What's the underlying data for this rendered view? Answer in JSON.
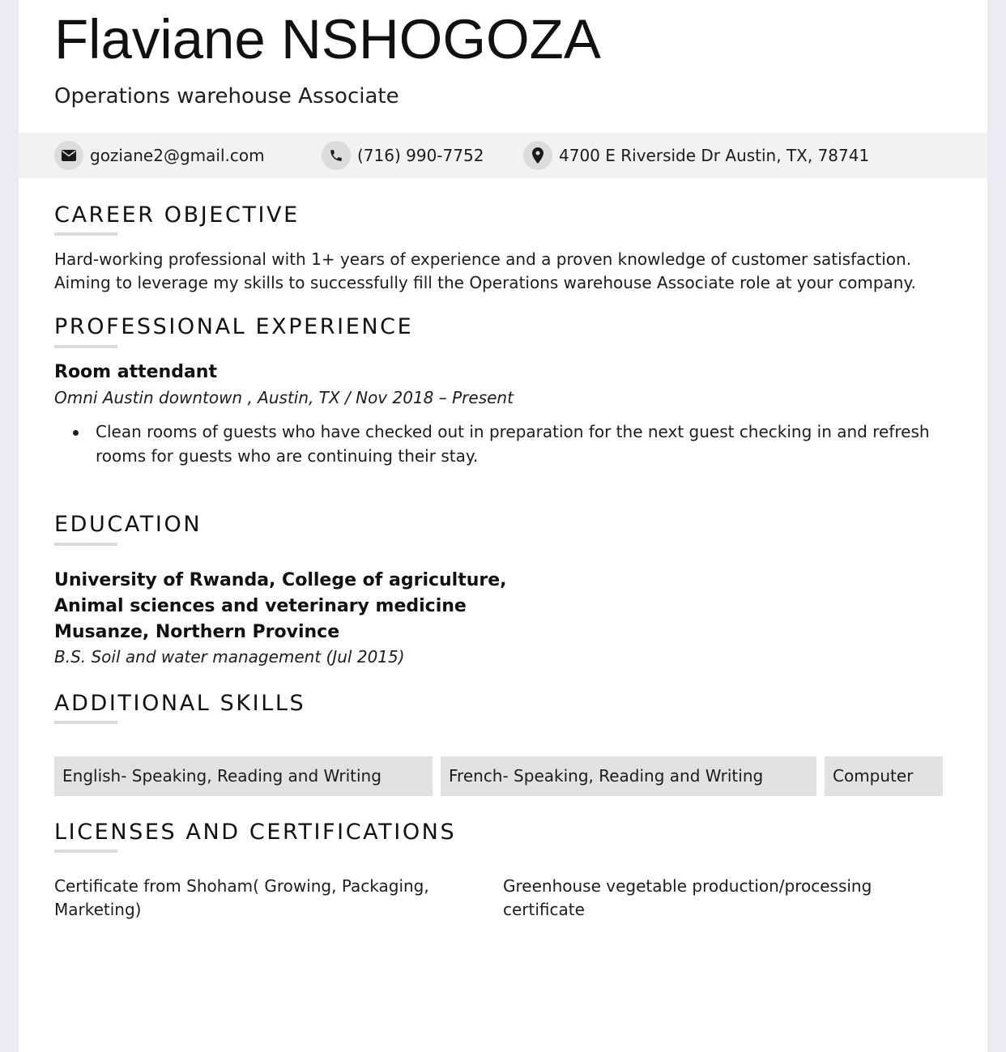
{
  "header": {
    "name": "Flaviane NSHOGOZA",
    "job_title": "Operations warehouse Associate"
  },
  "contact": {
    "email": "goziane2@gmail.com",
    "phone": "(716) 990-7752",
    "address": "4700 E Riverside Dr Austin, TX, 78741",
    "icons": [
      "envelope-icon",
      "phone-icon",
      "location-pin-icon"
    ]
  },
  "career_objective": {
    "heading": "CAREER OBJECTIVE",
    "line1": "Hard-working professional with 1+ years of experience and a proven knowledge of customer satisfaction.",
    "line2": "Aiming to leverage my skills to successfully fill the Operations warehouse Associate role at your company."
  },
  "experience": {
    "heading": "PROFESSIONAL EXPERIENCE",
    "jobs": [
      {
        "title": "Room attendant",
        "subtitle": "Omni Austin downtown , Austin, TX / Nov 2018 – Present",
        "bullets": [
          "Clean rooms of guests who have checked out in preparation for the next guest checking in and refresh rooms for guests who are continuing their stay."
        ]
      }
    ]
  },
  "education": {
    "heading": "EDUCATION",
    "lines": [
      "University of Rwanda, College of agriculture,",
      "Animal sciences and veterinary medicine",
      "Musanze, Northern Province"
    ],
    "degree": "B.S. Soil and water management (Jul 2015)"
  },
  "skills": {
    "heading": "ADDITIONAL SKILLS",
    "items": [
      "English- Speaking, Reading and Writing",
      "French- Speaking, Reading and Writing",
      "Computer"
    ]
  },
  "certifications": {
    "heading": "LICENSES AND CERTIFICATIONS",
    "items": [
      "Certificate from Shoham( Growing, Packaging, Marketing)",
      "Greenhouse vegetable production/processing certificate"
    ]
  },
  "colors": {
    "background": "#eceaf2",
    "page": "#ffffff",
    "contact_bar": "#f2f2f2",
    "chip": "#e2e2e2",
    "rule": "#dadada",
    "text": "#1a1a1a"
  }
}
